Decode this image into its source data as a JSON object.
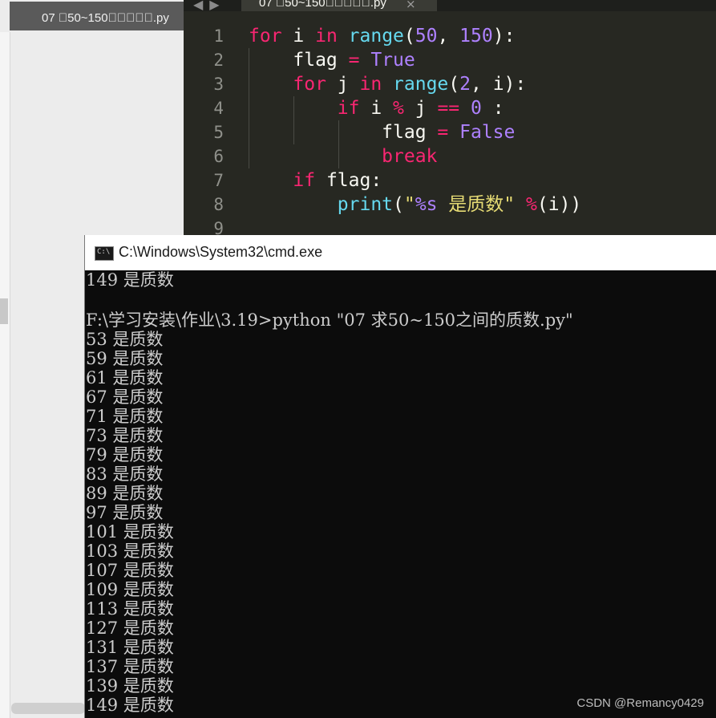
{
  "editor": {
    "tab_title": "07 \u000050~150\u0000\u0000\u0000\u0000\u0000.py",
    "close_glyph": "×",
    "line_numbers": [
      "1",
      "2",
      "3",
      "4",
      "5",
      "6",
      "7",
      "8",
      "9"
    ]
  },
  "sidebar": {
    "file_item": "07 \u000050~150\u0000\u0000\u0000\u0000\u0000.py"
  },
  "cmd": {
    "title": "C:\\Windows\\System32\\cmd.exe",
    "icon_text": "C:\\",
    "first_line": "149 是质数",
    "command_line": "F:\\学习安装\\作业\\3.19>python \"07 求50~150之间的质数.py\"",
    "primes": [
      "53",
      "59",
      "61",
      "67",
      "71",
      "73",
      "79",
      "83",
      "89",
      "97",
      "101",
      "103",
      "107",
      "109",
      "113",
      "127",
      "131",
      "137",
      "139",
      "149"
    ],
    "suffix": " 是质数"
  },
  "watermark": "CSDN @Remancy0429"
}
